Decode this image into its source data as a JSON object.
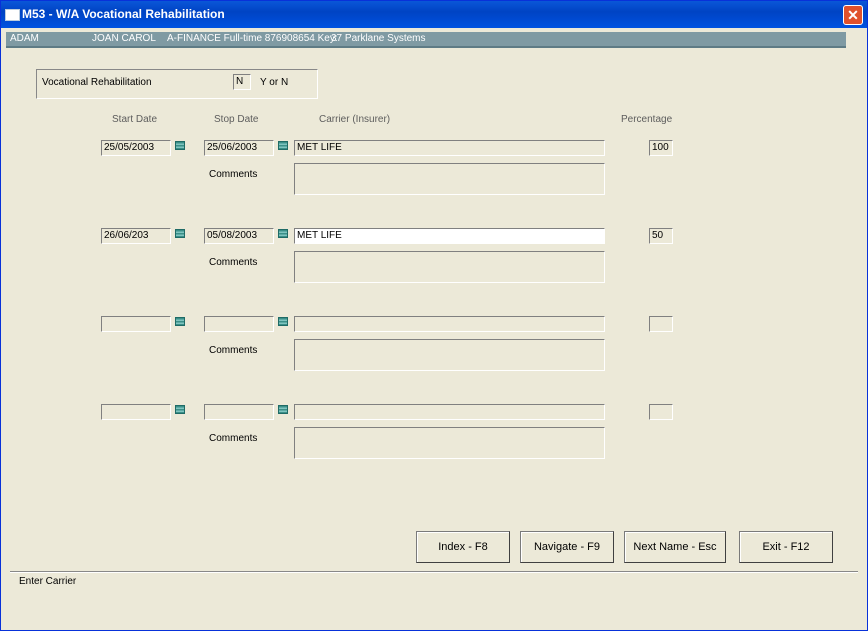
{
  "window": {
    "title": "M53 - W/A Vocational Rehabilitation",
    "close_glyph": "✕"
  },
  "infobar": {
    "last_name": "ADAM",
    "first_name": "JOAN CAROL",
    "details": "A-FINANCE  Full-time 876908654 Key:",
    "key_value": "37 Parklane Systems"
  },
  "vocational": {
    "label": "Vocational Rehabilitation",
    "value": "N",
    "hint": "Y or N"
  },
  "headers": {
    "start": "Start Date",
    "stop": "Stop Date",
    "carrier": "Carrier (Insurer)",
    "percentage": "Percentage",
    "comments": "Comments"
  },
  "rows": [
    {
      "start": "25/05/2003",
      "stop": "25/06/2003",
      "carrier": "MET LIFE",
      "percentage": "100",
      "comments": "",
      "comments_label": "Comments"
    },
    {
      "start": "26/06/203",
      "stop": "05/08/2003",
      "carrier": "MET LIFE",
      "percentage": "50",
      "comments": "",
      "comments_label": "Comments"
    },
    {
      "start": "",
      "stop": "",
      "carrier": "",
      "percentage": "",
      "comments": "",
      "comments_label": "Comments"
    },
    {
      "start": "",
      "stop": "",
      "carrier": "",
      "percentage": "",
      "comments": "",
      "comments_label": "Comments"
    }
  ],
  "buttons": {
    "index": "Index - F8",
    "navigate": "Navigate - F9",
    "next_name": "Next Name - Esc",
    "exit": "Exit - F12"
  },
  "status": "Enter Carrier",
  "colors": {
    "titlebar": "#0a57d8",
    "infobar": "#7f9aa3",
    "background": "#ece9d8",
    "calendar": "#3a8f88"
  }
}
